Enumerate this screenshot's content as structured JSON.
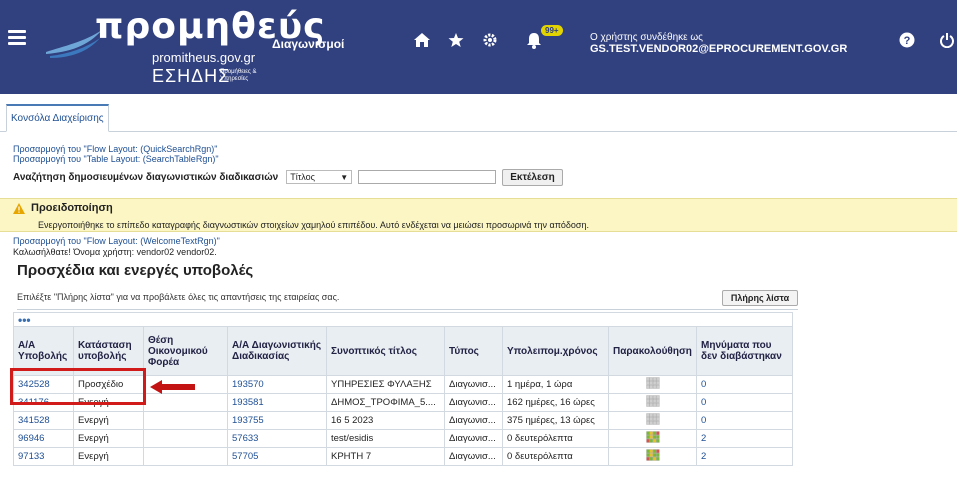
{
  "header": {
    "logo_text": "προμηθεύς",
    "logo_url": "promitheus.gov.gr",
    "logo_org": "ΕΣΗΔΗΣ",
    "logo_org_sub": "Προμήθειες & Υπηρεσίες",
    "app_title": "Διαγωνισμοί",
    "notifications_badge": "99+",
    "user_label": "Ο χρήστης συνδέθηκε ως",
    "user_email": "GS.TEST.VENDOR02@EPROCUREMENT.GOV.GR",
    "icons": [
      "menu-icon",
      "home-icon",
      "star-icon",
      "gear-icon",
      "bell-icon",
      "help-icon",
      "power-icon"
    ]
  },
  "tabs": [
    {
      "label": "Κονσόλα Διαχείρισης"
    }
  ],
  "personalize": {
    "flow_quick": "Προσαρμογή του \"Flow Layout: (QuickSearchRgn)\"",
    "table_search": "Προσαρμογή του \"Table Layout: (SearchTableRgn)\"",
    "flow_welcome": "Προσαρμογή του \"Flow Layout: (WelcomeTextRgn)\""
  },
  "search": {
    "label": "Αναζήτηση δημοσιευμένων διαγωνιστικών διαδικασιών",
    "select_value": "Τίτλος",
    "input_value": "",
    "button_label": "Εκτέλεση"
  },
  "warning": {
    "title": "Προειδοποίηση",
    "message": "Ενεργοποιήθηκε το επίπεδο καταγραφής διαγνωστικών στοιχείων χαμηλού επιπέδου. Αυτό ενδέχεται να μειώσει προσωρινά την απόδοση."
  },
  "welcome": "Καλωσήλθατε! Όνομα χρήστη: vendor02 vendor02.",
  "section_title": "Προσχέδια και ενεργές υποβολές",
  "info_text": "Επιλέξτε \"Πλήρης λίστα\" για να προβάλετε όλες τις απαντήσεις της εταιρείας σας.",
  "full_list_button": "Πλήρης λίστα",
  "table": {
    "dots": "•••",
    "headers": [
      "Α/Α Υποβολής",
      "Κατάσταση υποβολής",
      "Θέση Οικονομικού Φορέα",
      "Α/Α Διαγωνιστικής Διαδικασίας",
      "Συνοπτικός τίτλος",
      "Τύπος",
      "Υπολειπομ.χρόνος",
      "Παρακολούθηση",
      "Μηνύματα που δεν διαβάστηκαν"
    ],
    "rows": [
      {
        "id": "342528",
        "status": "Προσχέδιο",
        "position": "",
        "tender": "193570",
        "title": "ΥΠΗΡΕΣΙΕΣ ΦΥΛΑΞΗΣ",
        "type": "Διαγωνισ...",
        "remaining": "1 ημέρα, 1 ώρα",
        "monitor": "grid-gray-icon",
        "unread": "0"
      },
      {
        "id": "341176",
        "status": "Ενεργή",
        "position": "",
        "tender": "193581",
        "title": "ΔΗΜΟΣ_ΤΡΟΦΙΜΑ_5....",
        "type": "Διαγωνισ...",
        "remaining": "162 ημέρες, 16 ώρες",
        "monitor": "grid-gray-icon",
        "unread": "0"
      },
      {
        "id": "341528",
        "status": "Ενεργή",
        "position": "",
        "tender": "193755",
        "title": "16 5 2023",
        "type": "Διαγωνισ...",
        "remaining": "375 ημέρες, 13 ώρες",
        "monitor": "grid-gray-icon",
        "unread": "0"
      },
      {
        "id": "96946",
        "status": "Ενεργή",
        "position": "",
        "tender": "57633",
        "title": "test/esidis",
        "type": "Διαγωνισ...",
        "remaining": "0 δευτερόλεπτα",
        "monitor": "grid-color-icon",
        "unread": "2"
      },
      {
        "id": "97133",
        "status": "Ενεργή",
        "position": "",
        "tender": "57705",
        "title": "ΚΡΗΤΗ 7",
        "type": "Διαγωνισ...",
        "remaining": "0 δευτερόλεπτα",
        "monitor": "grid-color-icon",
        "unread": "2"
      }
    ]
  },
  "colors": {
    "header_bg": "#31407f",
    "link": "#1e4f93",
    "warning_bg": "#fbf6c4",
    "highlight": "#d11a1a"
  }
}
